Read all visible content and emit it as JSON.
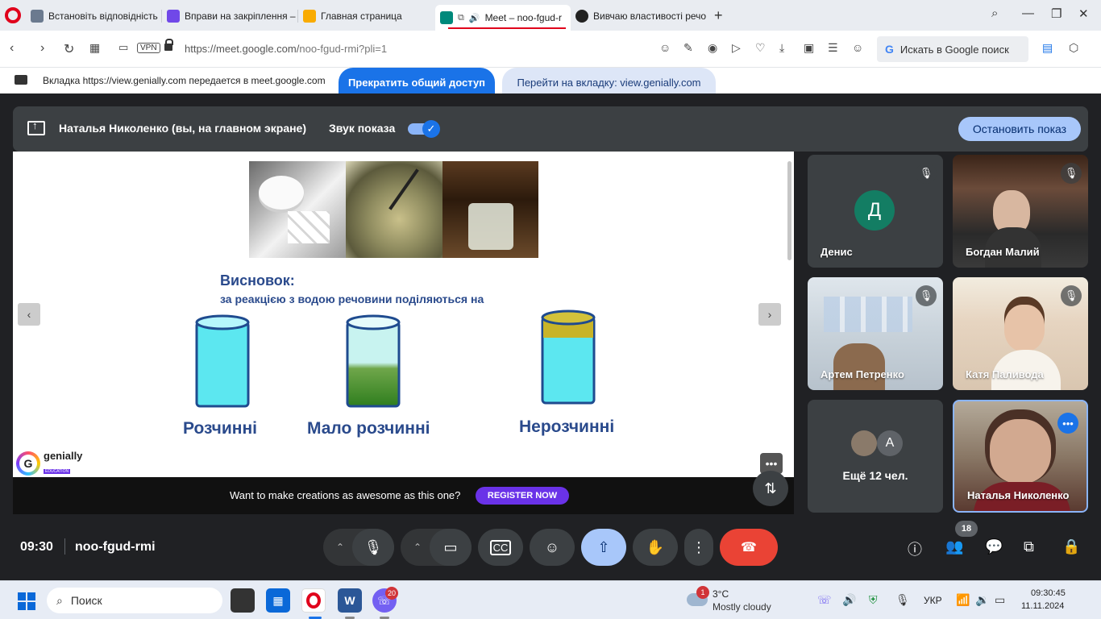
{
  "browser": {
    "tabs": [
      {
        "label": "Встановіть відповідність",
        "icon": "doc-icon",
        "color": "#6b7a8f"
      },
      {
        "label": "Вправи на закріплення –",
        "icon": "app-icon",
        "color": "#7048e8"
      },
      {
        "label": "Главная страница",
        "icon": "classroom-icon",
        "color": "#f9ab00"
      },
      {
        "label": "Meet – noo-fgud-r",
        "icon": "meet-icon",
        "color": "#00897b"
      },
      {
        "label": "Вивчаю властивості речо",
        "icon": "genially-icon",
        "color": "#222222"
      }
    ],
    "url_host": "https://meet.google.com/",
    "url_path": "noo-fgud-rmi?pli=1",
    "vpn_label": "VPN",
    "search_placeholder": "Искать в Google поиск",
    "search_g": "G"
  },
  "share_bar": {
    "text": "Вкладка https://view.genially.com передается в meet.google.com",
    "stop_button": "Прекратить общий доступ",
    "goto_button": "Перейти на вкладку: view.genially.com"
  },
  "meet": {
    "present_title": "Наталья Николенко (вы, на главном экране)",
    "sound_label": "Звук показа",
    "stop_present": "Остановить показ",
    "time": "09:30",
    "meeting_code": "noo-fgud-rmi",
    "participants_count": "18",
    "accent": "#1a73e8",
    "end_call_color": "#ea4335"
  },
  "slide": {
    "conclusion_title": "Висновок:",
    "conclusion_sub": "за реакцією з водою речовини поділяються на",
    "glasses": [
      {
        "label": "Розчинні",
        "fill": "water"
      },
      {
        "label": "Мало розчинні",
        "fill": "green-sediment"
      },
      {
        "label": "Нерозчинні",
        "fill": "yellow-top"
      }
    ],
    "brand": "genially",
    "brand_sub": "EDUCATION",
    "promo_text": "Want to make creations as awesome as this one?",
    "register_button": "REGISTER NOW"
  },
  "tiles": [
    {
      "name": "Денис",
      "initial": "Д",
      "muted": true
    },
    {
      "name": "Богдан Малий",
      "muted": true
    },
    {
      "name": "Артем Петренко",
      "muted": true
    },
    {
      "name": "Катя Паливода",
      "muted": true
    },
    {
      "name": "Ещё 12 чел.",
      "initial": "А"
    },
    {
      "name": "Наталья Николенко"
    }
  ],
  "taskbar": {
    "search_label": "Поиск",
    "viber_badge": "20",
    "weather_badge": "1",
    "weather_temp": "3°C",
    "weather_desc": "Mostly cloudy",
    "lang": "УКР",
    "time": "09:30:45",
    "date": "11.11.2024"
  }
}
